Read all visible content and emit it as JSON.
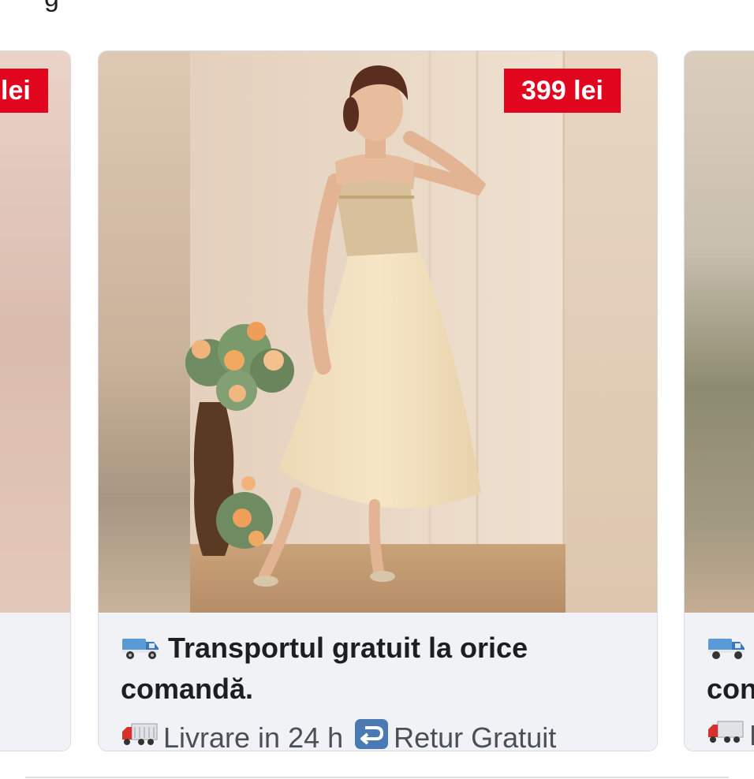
{
  "header": {
    "partial_text": "g"
  },
  "cards": [
    {
      "position": "left",
      "price": "lei",
      "photo_colors": [
        "#e6cbbf",
        "#d2b4a4",
        "#e0c5b6"
      ]
    },
    {
      "position": "main",
      "price": "399 lei",
      "promo_line1": "Transportul gratuit la orice",
      "promo_line2": "comandă.",
      "delivery_text": "Livrare in 24 h",
      "return_text": "Retur Gratuit",
      "icons": [
        "delivery-truck-icon",
        "lorry-icon",
        "return-arrow-icon"
      ]
    },
    {
      "position": "right",
      "promo_line2": "con",
      "delivery_text": "L",
      "icons": [
        "delivery-truck-icon",
        "lorry-icon"
      ]
    }
  ],
  "colors": {
    "price_badge": "#e2051e",
    "footer_bg": "#f0f2f5",
    "text_primary": "#1c1e21",
    "text_secondary": "#4b4f56",
    "card_border": "#d8dadf"
  }
}
